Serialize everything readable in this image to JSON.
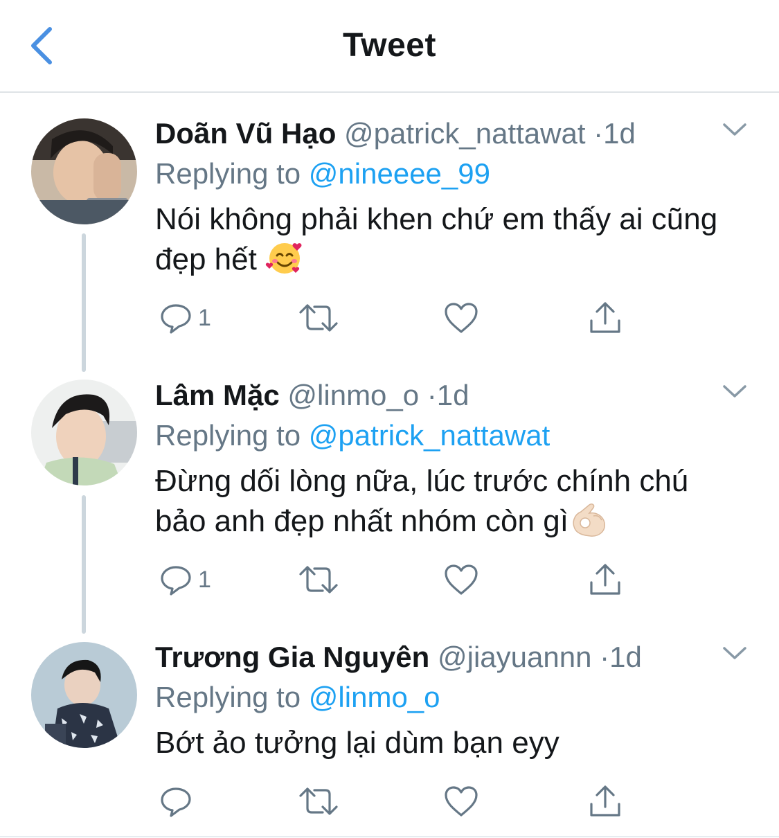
{
  "header": {
    "title": "Tweet",
    "back_icon": "chevron-left-icon"
  },
  "colors": {
    "accent": "#1da1f2",
    "back_arrow": "#4a90e2",
    "secondary_text": "#657786",
    "thread_line": "#ccd6dd"
  },
  "tweets": [
    {
      "name": "Doãn Vũ Hạo",
      "handle": "@patrick_nattawat",
      "dot": "·",
      "time": "1d",
      "replying_label": "Replying to",
      "replying_to": "@nineeee_99",
      "text_line1": "Nói không phải khen chứ em thấy ai cũng",
      "text_line2": "đẹp hết",
      "emoji": "smiling-face-with-hearts-icon",
      "reply_count": "1"
    },
    {
      "name": "Lâm Mặc",
      "handle": "@linmo_o",
      "dot": "·",
      "time": "1d",
      "replying_label": "Replying to",
      "replying_to": "@patrick_nattawat",
      "text_line1": "Đừng dối lòng nữa, lúc trước chính chú",
      "text_line2": "bảo anh đẹp nhất nhóm còn gì",
      "emoji": "ok-hand-icon",
      "reply_count": "1"
    },
    {
      "name": "Trương Gia Nguyên",
      "handle": "@jiayuannn",
      "dot": "·",
      "time": "1d",
      "replying_label": "Replying to",
      "replying_to": "@linmo_o",
      "text_line1": "Bớt ảo tưởng lại dùm bạn eyy",
      "reply_count": ""
    }
  ]
}
